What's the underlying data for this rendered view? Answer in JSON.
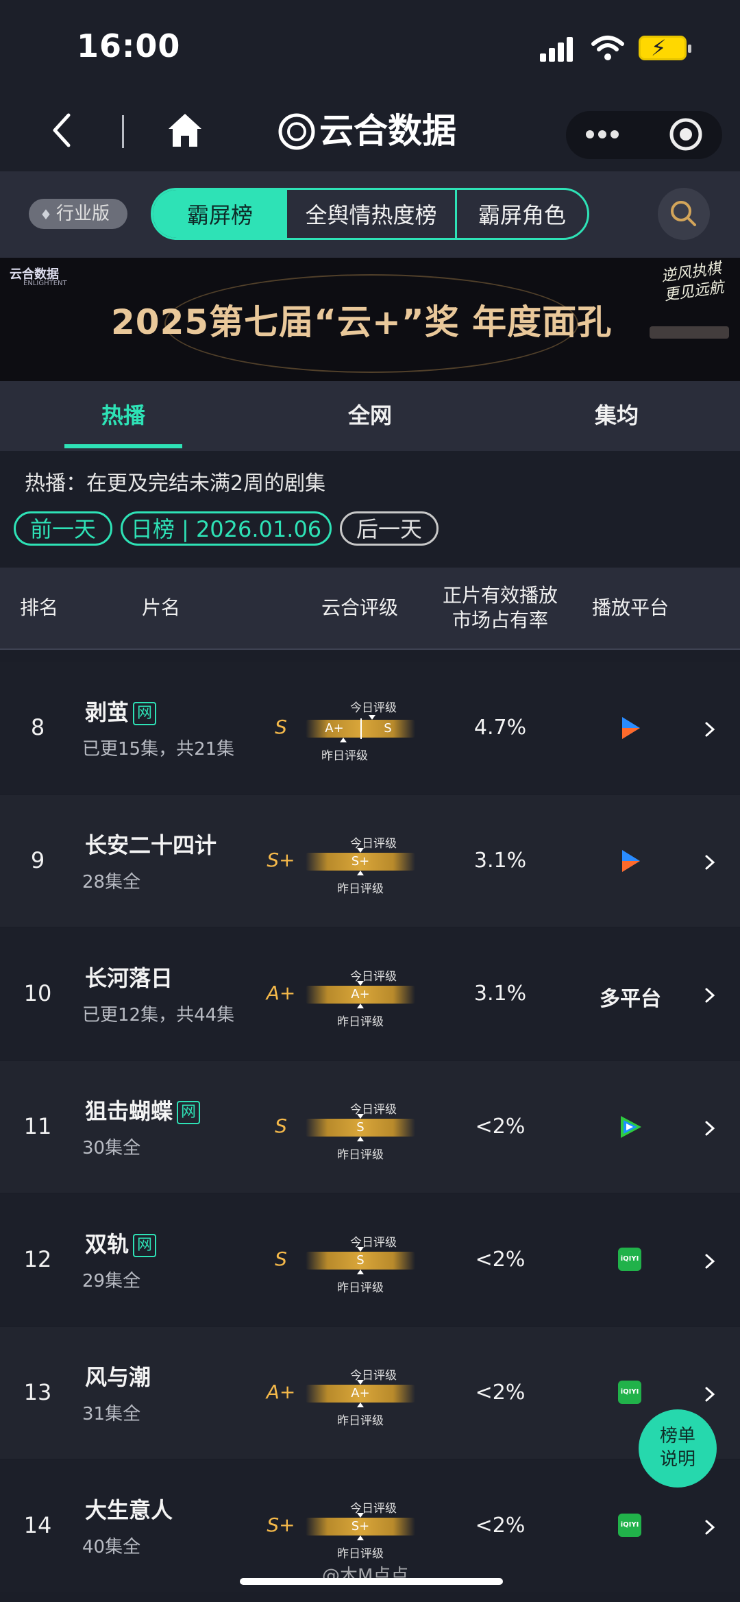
{
  "status": {
    "time": "16:00"
  },
  "header": {
    "title": "云合数据"
  },
  "filters": {
    "badge": "行业版",
    "segments": [
      "霸屏榜",
      "全舆情热度榜",
      "霸屏角色"
    ]
  },
  "banner": {
    "brand": "云合数据",
    "brand_en": "ENLIGHTENT",
    "headline": "2025第七届“云+”奖  年度面孔",
    "slogan_1": "逆风执棋",
    "slogan_2": "更见远航"
  },
  "tabs": [
    "热播",
    "全网",
    "集均"
  ],
  "description": "热播：在更及完结未满2周的剧集",
  "date_nav": {
    "prev": "前一天",
    "current": "日榜 | 2026.01.06",
    "next": "后一天"
  },
  "table": {
    "headers": {
      "rank": "排名",
      "title": "片名",
      "rating": "云合评级",
      "share_1": "正片有效播放",
      "share_2": "市场占有率",
      "platform": "播放平台"
    },
    "today_label": "今日评级",
    "yesterday_label": "昨日评级",
    "net_tag": "网",
    "rows": [
      {
        "rank": "8",
        "title": "剥茧",
        "net": true,
        "episodes": "已更15集，共21集",
        "grade": "S",
        "bar_left": "A+",
        "bar_right": "S",
        "split": true,
        "share": "4.7%",
        "platform": "youku",
        "platform_text": ""
      },
      {
        "rank": "9",
        "title": "长安二十四计",
        "net": false,
        "episodes": "28集全",
        "grade": "S+",
        "bar_left": "S+",
        "bar_right": "",
        "split": false,
        "share": "3.1%",
        "platform": "youku",
        "platform_text": ""
      },
      {
        "rank": "10",
        "title": "长河落日",
        "net": false,
        "episodes": "已更12集，共44集",
        "grade": "A+",
        "bar_left": "A+",
        "bar_right": "",
        "split": false,
        "share": "3.1%",
        "platform": "multi",
        "platform_text": "多平台"
      },
      {
        "rank": "11",
        "title": "狙击蝴蝶",
        "net": true,
        "episodes": "30集全",
        "grade": "S",
        "bar_left": "S",
        "bar_right": "",
        "split": false,
        "share": "<2%",
        "platform": "tencent",
        "platform_text": ""
      },
      {
        "rank": "12",
        "title": "双轨",
        "net": true,
        "episodes": "29集全",
        "grade": "S",
        "bar_left": "S",
        "bar_right": "",
        "split": false,
        "share": "<2%",
        "platform": "iqiyi",
        "platform_text": "iQIYI"
      },
      {
        "rank": "13",
        "title": "风与潮",
        "net": false,
        "episodes": "31集全",
        "grade": "A+",
        "bar_left": "A+",
        "bar_right": "",
        "split": false,
        "share": "<2%",
        "platform": "iqiyi",
        "platform_text": "iQIYI"
      },
      {
        "rank": "14",
        "title": "大生意人",
        "net": false,
        "episodes": "40集全",
        "grade": "S+",
        "bar_left": "S+",
        "bar_right": "",
        "split": false,
        "share": "<2%",
        "platform": "iqiyi",
        "platform_text": "iQIYI"
      }
    ]
  },
  "help_button": {
    "line1": "榜单",
    "line2": "说明"
  },
  "watermark": "@木M点点",
  "colors": {
    "accent": "#2ee2b6",
    "grade": "#f5b94a",
    "bar": "#d9a63a",
    "iqiyi": "#21b24a"
  }
}
